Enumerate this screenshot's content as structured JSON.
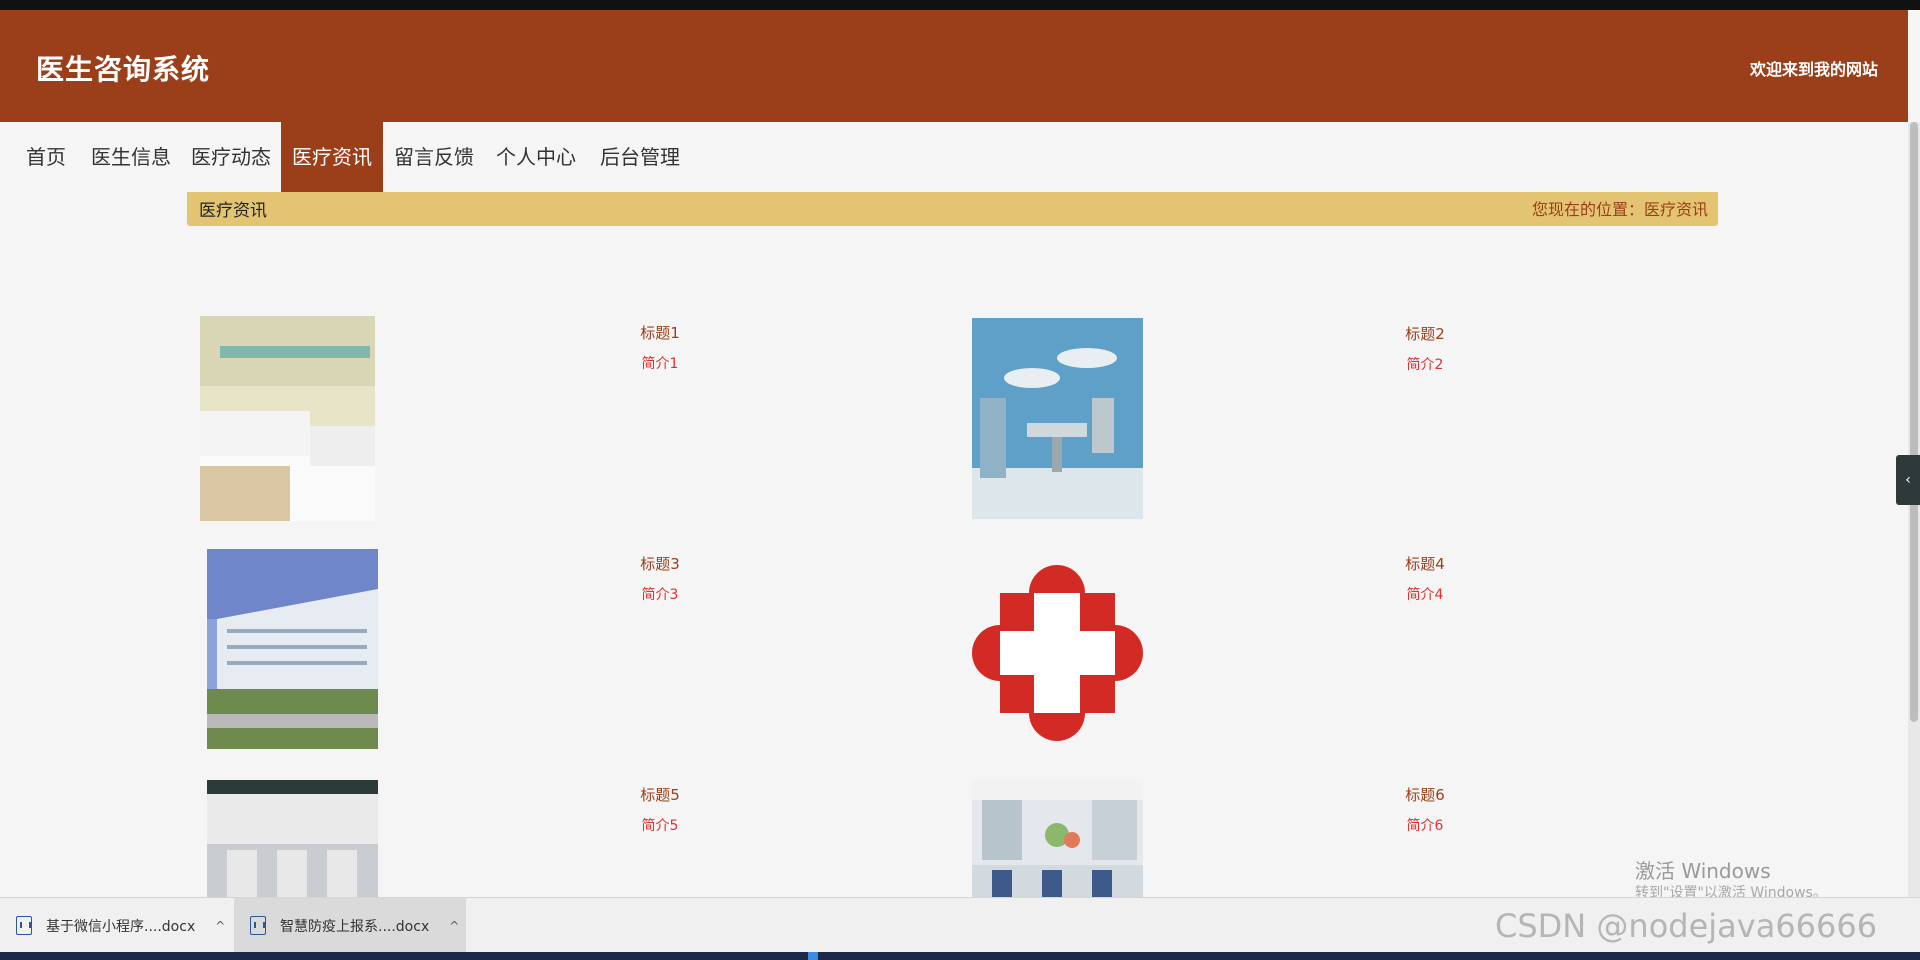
{
  "header": {
    "site_title": "医生咨询系统",
    "welcome": "欢迎来到我的网站"
  },
  "nav": {
    "items": [
      {
        "label": "首页",
        "active": false
      },
      {
        "label": "医生信息",
        "active": false
      },
      {
        "label": "医疗动态",
        "active": false
      },
      {
        "label": "医疗资讯",
        "active": true
      },
      {
        "label": "留言反馈",
        "active": false
      },
      {
        "label": "个人中心",
        "active": false
      },
      {
        "label": "后台管理",
        "active": false
      }
    ]
  },
  "breadcrumb": {
    "section_title": "医疗资讯",
    "location": "您现在的位置：医疗资讯"
  },
  "news": [
    {
      "title": "标题1",
      "intro": "简介1",
      "image": "hospital-ward-photo"
    },
    {
      "title": "标题2",
      "intro": "简介2",
      "image": "operating-room-photo"
    },
    {
      "title": "标题3",
      "intro": "简介3",
      "image": "hospital-building-photo"
    },
    {
      "title": "标题4",
      "intro": "简介4",
      "image": "red-cross-logo"
    },
    {
      "title": "标题5",
      "intro": "简介5",
      "image": "hospital-entrance-photo"
    },
    {
      "title": "标题6",
      "intro": "简介6",
      "image": "infusion-room-photo"
    }
  ],
  "colors": {
    "brand": "#9b3f1a",
    "breadcrumb_bg": "#e3c472",
    "intro_red": "#e0312f"
  },
  "side_toggle": {
    "icon": "chevron-left-icon",
    "glyph": "‹"
  },
  "watermark": {
    "line1": "激活 Windows",
    "line2": "转到\"设置\"以激活 Windows。"
  },
  "downloads": [
    {
      "name": "基于微信小程序....docx"
    },
    {
      "name": "智慧防疫上报系....docx"
    }
  ],
  "csdn": "CSDN @nodejava66666"
}
